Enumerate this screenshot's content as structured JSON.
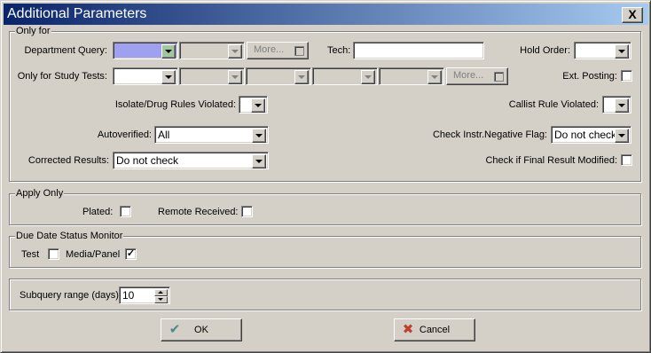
{
  "window": {
    "title": "Additional Parameters",
    "close_label": "X"
  },
  "only_for": {
    "title": "Only for",
    "department_query_label": "Department Query:",
    "department_query_value": "",
    "department_query_value2": "",
    "more_label": "More...",
    "tech_label": "Tech:",
    "tech_value": "",
    "hold_order_label": "Hold Order:",
    "hold_order_value": "",
    "study_tests_label": "Only for Study Tests:",
    "study_tests_values": [
      "",
      "",
      "",
      "",
      ""
    ],
    "study_more_label": "More...",
    "ext_posting_label": "Ext. Posting:",
    "isolate_drug_label": "Isolate/Drug Rules Violated:",
    "isolate_drug_value": "",
    "callist_label": "Callist Rule Violated:",
    "callist_value": "",
    "autoverified_label": "Autoverified:",
    "autoverified_value": "All",
    "check_instr_label": "Check Instr.Negative Flag:",
    "check_instr_value": "Do not check",
    "corrected_label": "Corrected Results:",
    "corrected_value": "Do not check",
    "final_modified_label": "Check if Final Result Modified:"
  },
  "apply_only": {
    "title": "Apply Only",
    "plated_label": "Plated:",
    "plated_checked": false,
    "remote_label": "Remote Received:",
    "remote_checked": false
  },
  "due_date": {
    "title": "Due Date Status Monitor",
    "test_label": "Test",
    "test_checked": false,
    "media_label": "Media/Panel",
    "media_checked": true,
    "check_mark": "✓"
  },
  "subquery": {
    "label": "Subquery range (days):",
    "value": "10"
  },
  "buttons": {
    "ok_label": "OK",
    "ok_icon": "✔",
    "cancel_label": "Cancel",
    "cancel_icon": "✖"
  },
  "colors": {
    "title_start": "#0a246a",
    "title_end": "#a6caf0",
    "highlight": "#a0a0f0"
  }
}
